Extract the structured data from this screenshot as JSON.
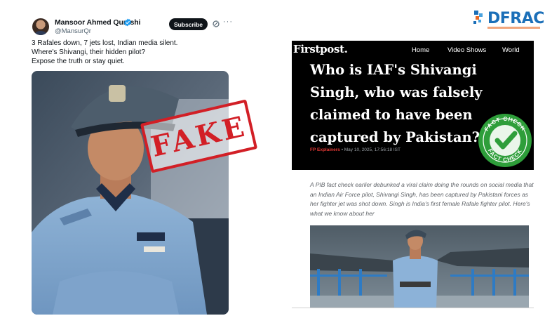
{
  "post": {
    "author_name": "Mansoor Ahmed Qureshi",
    "handle": "@MansurQr",
    "subscribe_label": "Subscribe",
    "more_label": "···",
    "text_lines": [
      "3 Rafales down, 7 jets lost, Indian media silent.",
      "Where's Shivangi, their hidden pilot?",
      "Expose the truth or stay quiet."
    ],
    "stamp_text": "FAKE",
    "icons": [
      "verified-badge-icon",
      "grok-icon",
      "more-icon"
    ]
  },
  "logo": {
    "word": "DFRAC"
  },
  "article": {
    "brand": "Firstpost.",
    "nav": [
      "Home",
      "Video Shows",
      "World"
    ],
    "headline": "Who is IAF's Shivangi Singh, who was falsely claimed to have been captured by Pakistan?",
    "meta_section": "FP Explainers",
    "meta_date": "• May 10, 2025, 17:56:18 IST",
    "badge_text": "FACT CHECK",
    "summary": "A PIB fact check earlier debunked a viral claim doing the rounds on social media that an Indian Air Force pilot, Shivangi Singh, has been captured by Pakistani forces as her fighter jet was shot down. Singh is India's first female Rafale fighter pilot. Here's what we know about her"
  },
  "colors": {
    "stamp_red": "#d21f26",
    "logo_blue": "#1b6fb8",
    "logo_orange": "#e86a24",
    "firstpost_red": "#e53935",
    "badge_green": "#2e9e3a"
  }
}
